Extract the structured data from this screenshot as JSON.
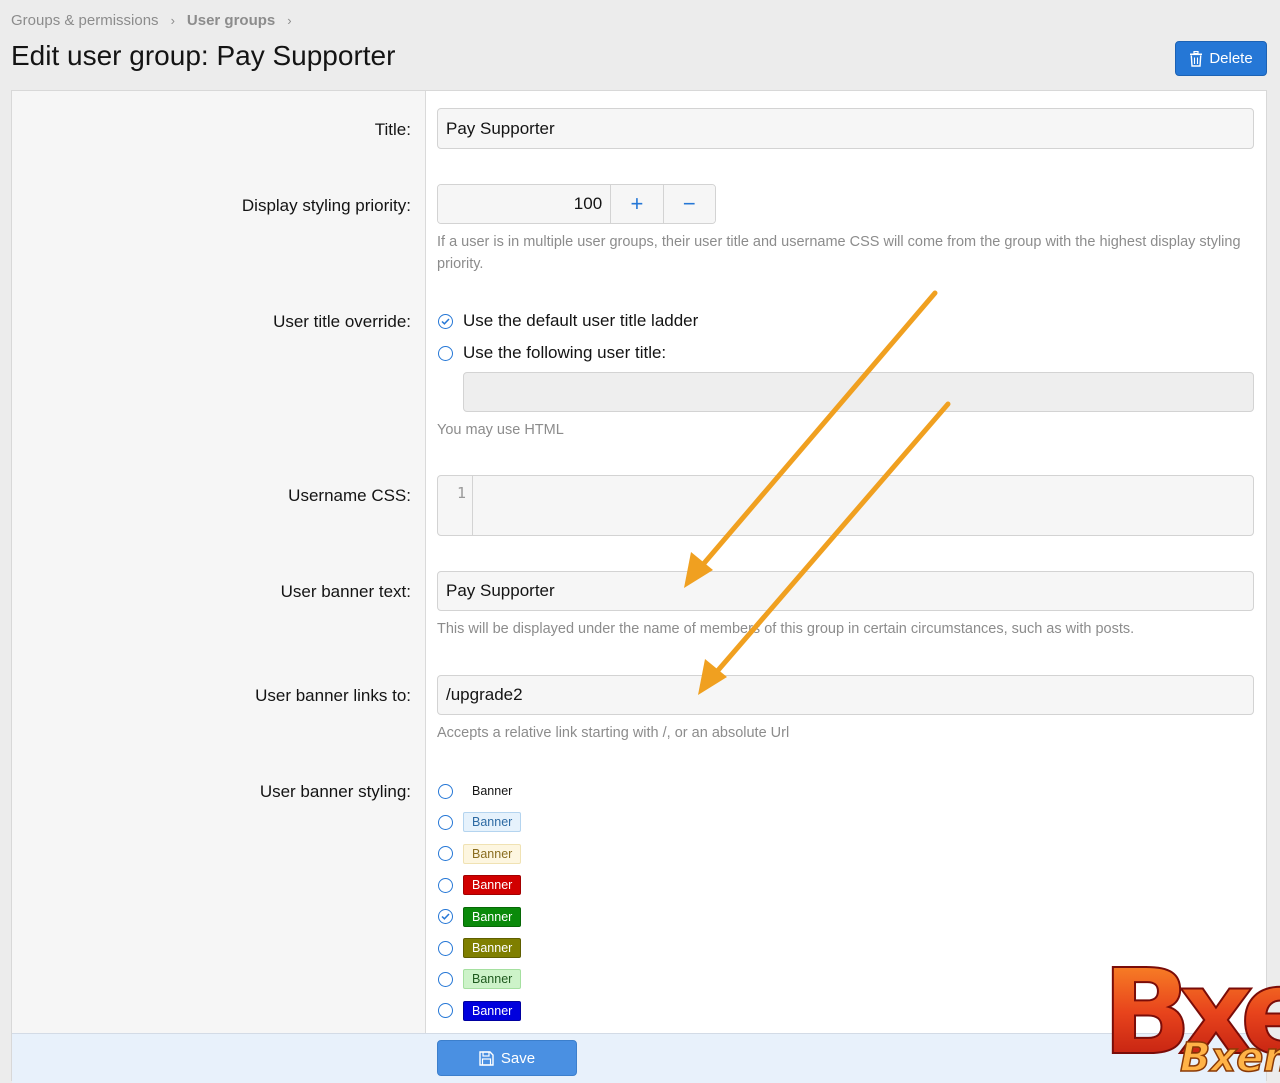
{
  "breadcrumb": {
    "items": [
      "Groups & permissions",
      "User groups"
    ],
    "sep": "›"
  },
  "page": {
    "title": "Edit user group: Pay Supporter"
  },
  "actions": {
    "delete_label": "Delete",
    "save_label": "Save"
  },
  "form": {
    "title": {
      "label": "Title:",
      "value": "Pay Supporter"
    },
    "priority": {
      "label": "Display styling priority:",
      "value": "100",
      "plus": "+",
      "minus": "−",
      "hint": "If a user is in multiple user groups, their user title and username CSS will come from the group with the highest display styling priority."
    },
    "user_title": {
      "label": "User title override:",
      "option_default": "Use the default user title ladder",
      "option_custom": "Use the following user title:",
      "selected": "default",
      "custom_value": "",
      "hint": "You may use HTML"
    },
    "username_css": {
      "label": "Username CSS:",
      "line_number": "1",
      "value": ""
    },
    "banner_text": {
      "label": "User banner text:",
      "value": "Pay Supporter",
      "hint": "This will be displayed under the name of members of this group in certain circumstances, such as with posts."
    },
    "banner_link": {
      "label": "User banner links to:",
      "value": "/upgrade2",
      "hint": "Accepts a relative link starting with /, or an absolute Url"
    },
    "banner_styling": {
      "label": "User banner styling:",
      "selected_index": 4,
      "options": [
        {
          "text": "Banner",
          "bg": "transparent",
          "fg": "#141414",
          "border": "transparent"
        },
        {
          "text": "Banner",
          "bg": "#e6f2fc",
          "fg": "#2d6aa3",
          "border": "#b4d4ef"
        },
        {
          "text": "Banner",
          "bg": "#fdf6e0",
          "fg": "#8a6d1f",
          "border": "#f0e2b3"
        },
        {
          "text": "Banner",
          "bg": "#d10000",
          "fg": "#ffffff",
          "border": "#a30000"
        },
        {
          "text": "Banner",
          "bg": "#0a8a0a",
          "fg": "#ffffff",
          "border": "#066806"
        },
        {
          "text": "Banner",
          "bg": "#7f7f00",
          "fg": "#ffffff",
          "border": "#5f5f00"
        },
        {
          "text": "Banner",
          "bg": "#cdf3c9",
          "fg": "#1f5a1f",
          "border": "#a5e0a0"
        },
        {
          "text": "Banner",
          "bg": "#0000dd",
          "fg": "#ffffff",
          "border": "#0000a0"
        }
      ]
    }
  },
  "watermark": {
    "text_big": "Bxen",
    "text_small": "Bxen"
  },
  "colors": {
    "accent": "#2577d6",
    "arrow": "#f0a020"
  }
}
